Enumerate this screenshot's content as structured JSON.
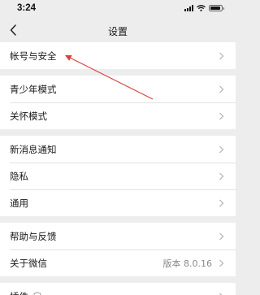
{
  "status_bar": {
    "time": "3:24",
    "battery_level": 0.95
  },
  "nav": {
    "title": "设置",
    "back_icon": "chevron-left-icon"
  },
  "groups": [
    {
      "items": [
        {
          "label": "帐号与安全"
        }
      ]
    },
    {
      "items": [
        {
          "label": "青少年模式"
        },
        {
          "label": "关怀模式"
        }
      ]
    },
    {
      "items": [
        {
          "label": "新消息通知"
        },
        {
          "label": "隐私"
        },
        {
          "label": "通用"
        }
      ]
    },
    {
      "items": [
        {
          "label": "帮助与反馈"
        },
        {
          "label": "关于微信",
          "value": "版本 8.0.16"
        }
      ]
    },
    {
      "items": [
        {
          "label": "插件",
          "icon": "shield-icon"
        }
      ]
    }
  ],
  "colors": {
    "background": "#ededed",
    "cell": "#ffffff",
    "annotation_arrow": "#d9423a"
  }
}
